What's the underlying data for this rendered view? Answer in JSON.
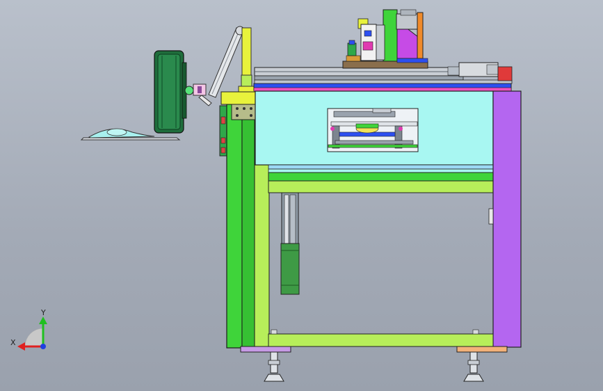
{
  "viewport": {
    "background_top": "#b9c0cb",
    "background_bottom": "#9aa1ad"
  },
  "triad": {
    "x_label": "X",
    "y_label": "Y",
    "x_color": "#e02020",
    "y_color": "#20c020",
    "z_color": "#2040e0"
  },
  "model": {
    "view": "front",
    "part_colors": {
      "frame_green": "#3fd43a",
      "frame_lime": "#b7ee5a",
      "panel_cyan": "#a8f7f2",
      "side_purple": "#b466f0",
      "rail_grey": "#9aa3ae",
      "monitor_green": "#1f6e3c",
      "arm_yellow": "#e8f23c",
      "magenta": "#e03ab0",
      "orange": "#f08a2a"
    }
  }
}
